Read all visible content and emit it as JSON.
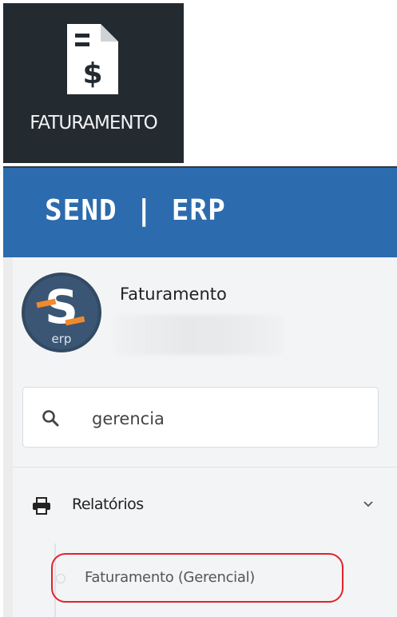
{
  "module_tile": {
    "label": "FATURAMENTO",
    "icon": "invoice-dollar-icon",
    "background": "#232a30"
  },
  "header": {
    "brand": "SEND | ERP",
    "background": "#2c6bad"
  },
  "profile": {
    "name": "Faturamento",
    "logo_text": "erp",
    "logo_letter": "S"
  },
  "search": {
    "value": "gerencia",
    "icon": "search-icon"
  },
  "menu": {
    "group_label": "Relatórios",
    "group_icon": "printer-icon",
    "items": [
      {
        "label": "Faturamento (Gerencial)",
        "highlight_color": "#e1222a"
      }
    ]
  }
}
